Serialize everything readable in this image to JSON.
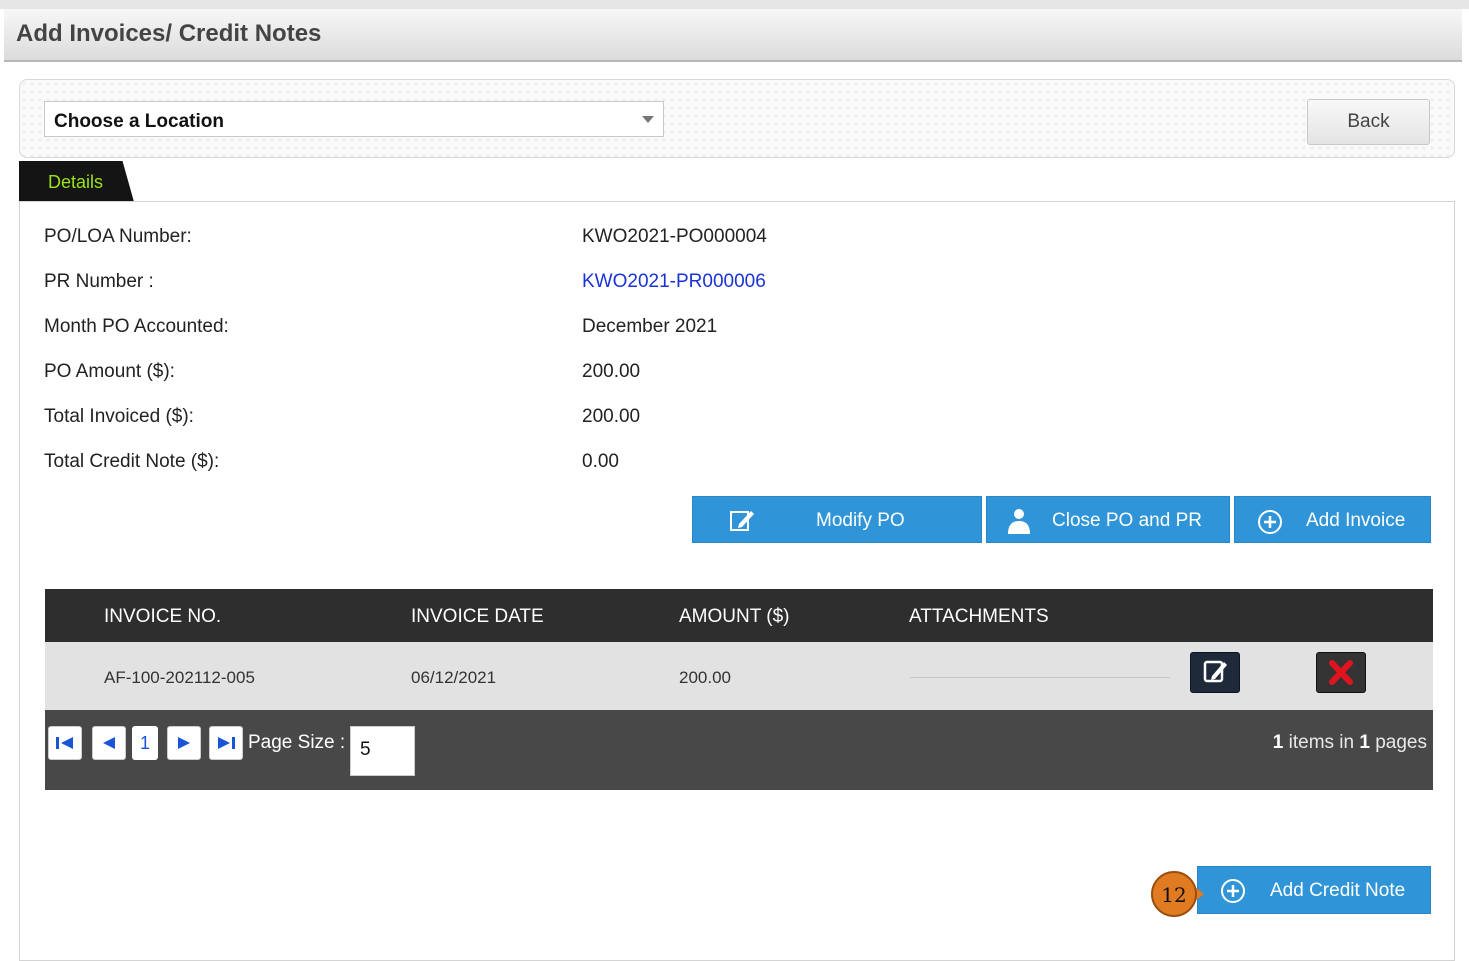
{
  "page": {
    "title": "Add Invoices/ Credit Notes"
  },
  "filter": {
    "location_placeholder": "Choose a Location",
    "back_label": "Back"
  },
  "tabs": [
    {
      "label": "Details"
    }
  ],
  "details": {
    "po_number_label": "PO/LOA Number:",
    "po_number_value": "KWO2021-PO000004",
    "pr_number_label": "PR Number :",
    "pr_number_value": "KWO2021-PR000006",
    "month_label": "Month PO Accounted:",
    "month_value": "December 2021",
    "po_amount_label": "PO Amount ($):",
    "po_amount_value": "200.00",
    "total_invoiced_label": "Total Invoiced ($):",
    "total_invoiced_value": "200.00",
    "total_credit_label": "Total Credit Note ($):",
    "total_credit_value": "0.00"
  },
  "actions": {
    "modify_po": "Modify PO",
    "close_po_pr": "Close PO and PR",
    "add_invoice": "Add Invoice",
    "add_credit_note": "Add Credit Note"
  },
  "grid": {
    "columns": [
      "INVOICE NO.",
      "INVOICE DATE",
      "AMOUNT ($)",
      "ATTACHMENTS"
    ],
    "rows": [
      {
        "invoice_no": "AF-100-202112-005",
        "invoice_date": "06/12/2021",
        "amount": "200.00",
        "attachments": ""
      }
    ]
  },
  "pager": {
    "current_page": "1",
    "page_size_label": "Page Size :",
    "page_size_value": "5",
    "items_count": "1",
    "items_text": " items in ",
    "pages_count": "1",
    "pages_text": " pages"
  },
  "callout": {
    "number": "12"
  },
  "colors": {
    "accent_blue": "#2f95d8",
    "link_blue": "#1a33d6",
    "tab_text": "#9be21b",
    "callout_orange": "#e07b22"
  }
}
